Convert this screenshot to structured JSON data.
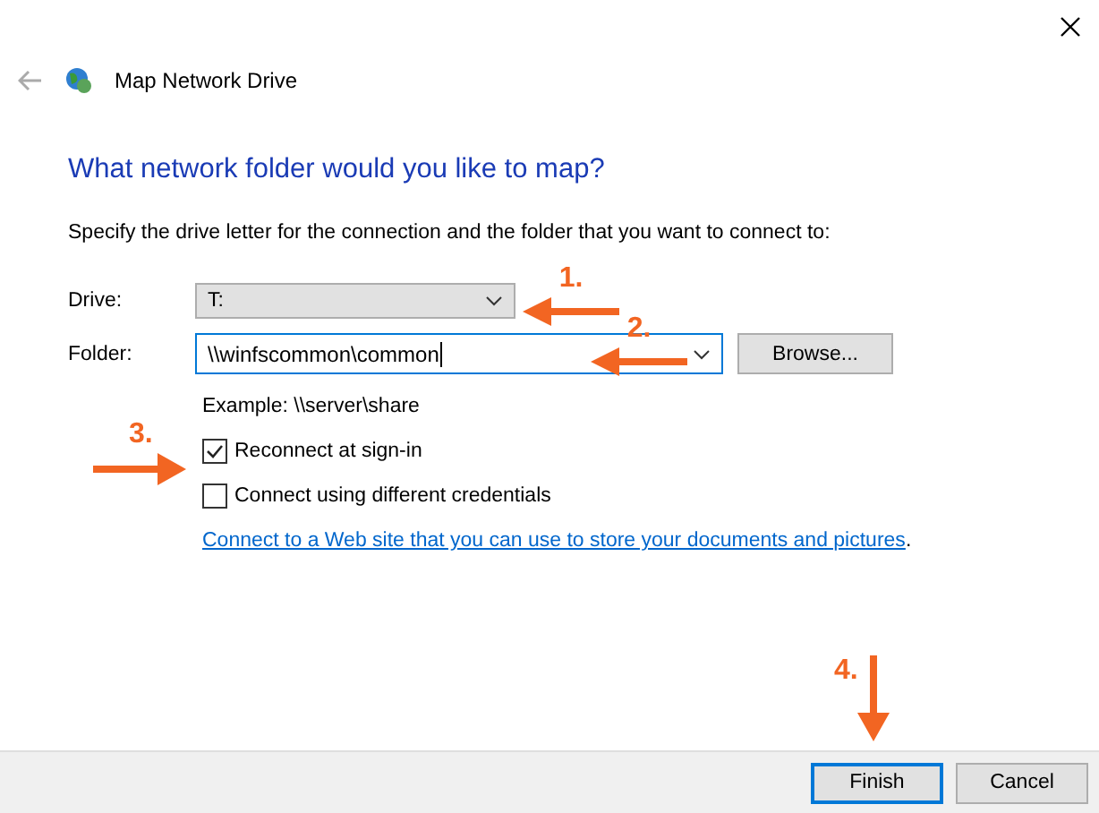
{
  "window": {
    "title": "Map Network Drive"
  },
  "heading": "What network folder would you like to map?",
  "instruction": "Specify the drive letter for the connection and the folder that you want to connect to:",
  "drive": {
    "label": "Drive:",
    "value": "T:"
  },
  "folder": {
    "label": "Folder:",
    "value": "\\\\winfscommon\\common",
    "focused": true
  },
  "browse_button": "Browse...",
  "example": "Example: \\\\server\\share",
  "options": [
    {
      "label": "Reconnect at sign-in",
      "checked": true
    },
    {
      "label": "Connect using different credentials",
      "checked": false
    }
  ],
  "link": "Connect to a Web site that you can use to store your documents and pictures",
  "link_suffix": ".",
  "buttons": [
    {
      "label": "Finish",
      "default": true
    },
    {
      "label": "Cancel",
      "default": false
    }
  ],
  "callouts": [
    {
      "label": "1.",
      "kind": "left"
    },
    {
      "label": "2.",
      "kind": "left"
    },
    {
      "label": "3.",
      "kind": "right"
    },
    {
      "label": "4.",
      "kind": "down"
    }
  ]
}
